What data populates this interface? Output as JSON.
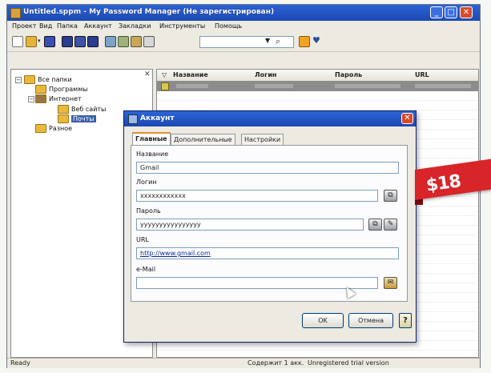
{
  "window": {
    "title": "Untitled.sppm - My Password Manager (Не зарегистрирован)",
    "controls": [
      "_",
      "□",
      "✕"
    ]
  },
  "menu": [
    "Проект",
    "Вид",
    "Папка",
    "Аккаунт",
    "Закладки",
    "Инструменты",
    "Помощь"
  ],
  "toolbar": {
    "icons": [
      "new-icon",
      "open-icon",
      "save-icon",
      "blue-tool-icon",
      "blue-tool-icon",
      "blue-tool-icon",
      "tool-icon",
      "tool-icon",
      "tool-icon",
      "tool-icon",
      "lock-icon",
      "heart-icon"
    ],
    "search_value": "",
    "search_icon": "magnifier-icon"
  },
  "tree": {
    "close": "✕",
    "items": [
      {
        "label": "Все папки",
        "level": 0,
        "expander": "−"
      },
      {
        "label": "Программы",
        "level": 1,
        "expander": ""
      },
      {
        "label": "Интернет",
        "level": 1,
        "expander": "−"
      },
      {
        "label": "Веб сайты",
        "level": 2,
        "expander": ""
      },
      {
        "label": "Почты",
        "level": 2,
        "expander": ""
      },
      {
        "label": "Разное",
        "level": 1,
        "expander": ""
      }
    ],
    "selected_index": 4
  },
  "list": {
    "sort_indicator": "▽",
    "columns": [
      "Название",
      "Логин",
      "Пароль",
      "URL"
    ]
  },
  "dialog": {
    "title": "Аккаунт",
    "close": "✕",
    "tabs": [
      "Главные",
      "Дополнительные",
      "Настройки"
    ],
    "active_tab": 0,
    "fields": {
      "name_label": "Название",
      "name_value": "Gmail",
      "login_label": "Логин",
      "login_value": "xxxxxxxxxxxx",
      "password_label": "Пароль",
      "password_value": "yyyyyyyyyyyyyyyy",
      "url_label": "URL",
      "url_value": "http://www.gmail.com",
      "email_label": "e-Mail",
      "email_value": ""
    },
    "buttons": {
      "ok": "OK",
      "cancel": "Отмена",
      "help": "?"
    }
  },
  "status": {
    "left": "Ready",
    "middle": "Содержит 1 акк.",
    "right": "Unregistered trial version"
  },
  "price_tag": {
    "text": "$18",
    "color": "#d8252a"
  },
  "colors": {
    "titlebar": "#1d49b2",
    "selection": "#3a5fa8",
    "row_highlight": "#8c8c8c"
  }
}
